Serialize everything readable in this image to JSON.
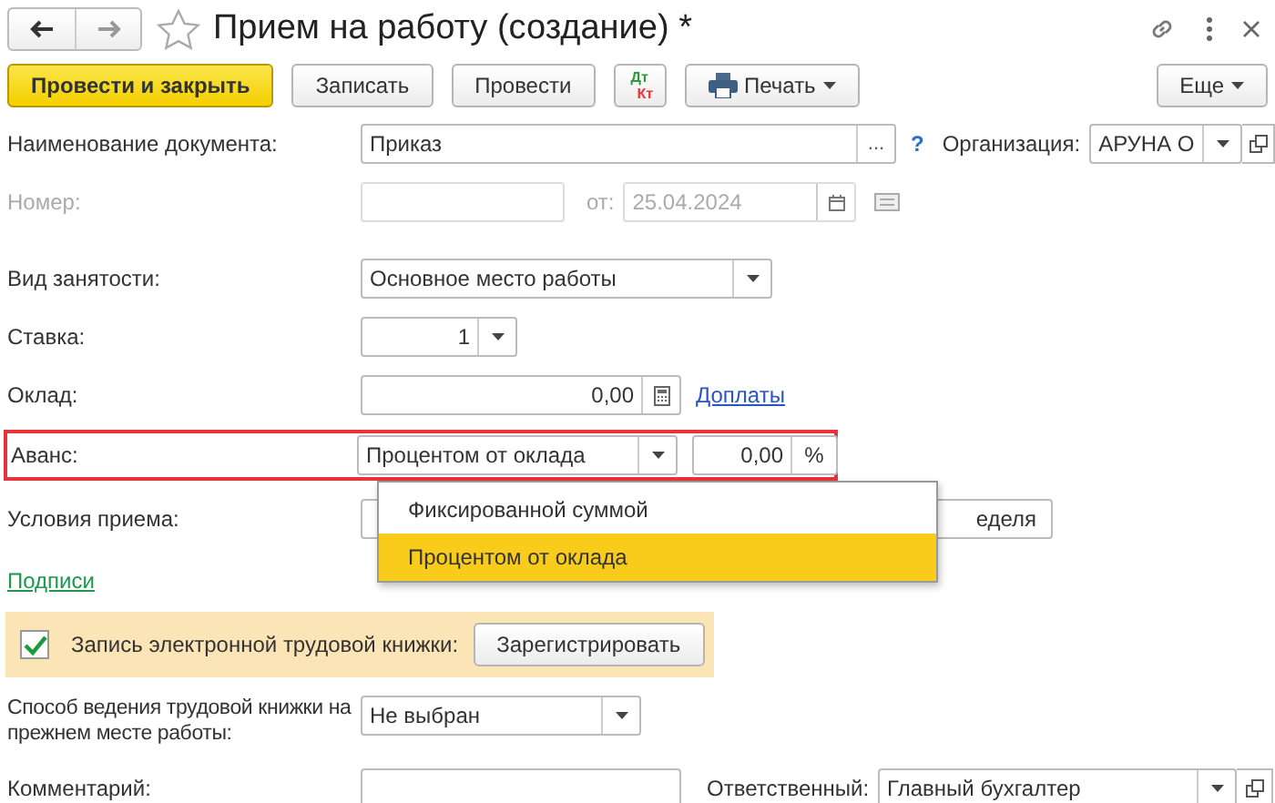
{
  "window": {
    "title": "Прием на работу (создание) *"
  },
  "toolbar": [
    {
      "kind": "primary",
      "label": "Провести и закрыть"
    },
    {
      "kind": "plain",
      "label": "Записать"
    },
    {
      "kind": "plain",
      "label": "Провести"
    },
    {
      "kind": "dtkt",
      "top": "Дт",
      "bottom": "Кт"
    },
    {
      "kind": "print",
      "label": "Печать"
    }
  ],
  "more_button": "Еще",
  "document_name": {
    "label": "Наименование документа:",
    "value": "Приказ",
    "choose": "...",
    "help": "?"
  },
  "organization": {
    "label": "Организация:",
    "value": "АРУНА О"
  },
  "number": {
    "label": "Номер:",
    "disabled": true,
    "date_label": "от:",
    "date": "25.04.2024"
  },
  "employment": {
    "label": "Вид занятости:",
    "value": "Основное место работы"
  },
  "rate": {
    "label": "Ставка:",
    "value": "1"
  },
  "salary": {
    "label": "Оклад:",
    "value": "0,00",
    "link": "Доплаты"
  },
  "advance": {
    "label": "Аванс:",
    "value": "Процентом от оклада",
    "amount": "0,00",
    "unit": "%",
    "highlighted": true
  },
  "advance_options": [
    {
      "label": "Фиксированной суммой",
      "selected": false
    },
    {
      "label": "Процентом от оклада",
      "selected": true
    }
  ],
  "conditions": {
    "label": "Условия приема:",
    "value_tail": "еделя"
  },
  "signatures_link": "Подписи",
  "etk": {
    "checked": true,
    "label": "Запись электронной трудовой книжки:",
    "button": "Зарегистрировать"
  },
  "previous_method": {
    "label": "Способ ведения трудовой книжки на прежнем месте работы:",
    "value": "Не выбран"
  },
  "comment": {
    "label": "Комментарий:"
  },
  "responsible": {
    "label": "Ответственный:",
    "value": "Главный бухгалтер"
  }
}
